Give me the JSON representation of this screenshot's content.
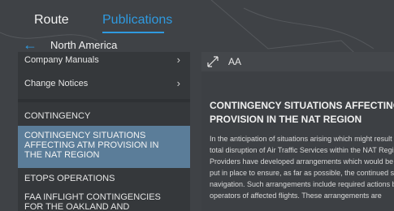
{
  "header": {
    "tabs": [
      {
        "label": "Route"
      },
      {
        "label": "Publications"
      }
    ],
    "breadcrumb": "North America"
  },
  "sidebar": {
    "items": [
      {
        "label": "Company Manuals"
      },
      {
        "label": "Change Notices"
      },
      {
        "label": "CONTINGENCY"
      },
      {
        "label": "CONTINGENCY SITUATIONS AFFECTING ATM PROVISION IN THE NAT REGION"
      },
      {
        "label": "ETOPS OPERATIONS"
      },
      {
        "label": "FAA INFLIGHT CONTINGENCIES FOR THE OAKLAND AND ANCHORAGE FIRS"
      }
    ]
  },
  "toolbar": {
    "font_size_label": "AA"
  },
  "document": {
    "title_lines": [
      "CONTINGENCY SITUATIONS AFFECTING ATM",
      "PROVISION IN THE NAT REGION"
    ],
    "body_lines": [
      "In the anticipation of situations arising which might result in the partial or",
      "total disruption of Air Traffic Services within the NAT Region, NAT ATS",
      "Providers have developed arrangements which would be",
      "put in place to ensure, as far as possible, the continued safety of air",
      "navigation. Such arrangements include required actions by",
      "operators of affected flights. These arrangements are"
    ]
  },
  "colors": {
    "accent": "#2f9ae0",
    "selected_row": "#5b7d99"
  },
  "icons": {
    "back": "arrow-left-icon",
    "expand": "expand-icon",
    "chevron": "chevron-right-icon"
  }
}
